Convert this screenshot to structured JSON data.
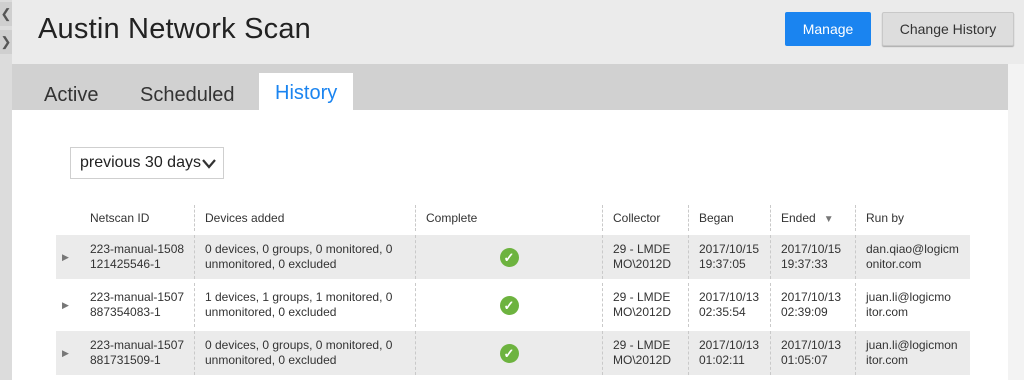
{
  "page": {
    "title": "Austin Network Scan"
  },
  "nav": {
    "back_arrow": "❮",
    "forward_arrow": "❯"
  },
  "header_buttons": {
    "manage": "Manage",
    "change_history": "Change History"
  },
  "tabs": [
    {
      "label": "Active",
      "active": false
    },
    {
      "label": "Scheduled",
      "active": false
    },
    {
      "label": "History",
      "active": true
    }
  ],
  "filter": {
    "selected": "previous 30 days"
  },
  "table": {
    "columns": [
      "Netscan ID",
      "Devices added",
      "Complete",
      "Collector",
      "Began",
      "Ended",
      "Run by"
    ],
    "sort_column": "Ended",
    "rows": [
      {
        "id_1": "223-manual-1508",
        "id_2": "121425546-1",
        "devices_1": "0 devices, 0 groups, 0 monitored, 0",
        "devices_2": "unmonitored, 0 excluded",
        "complete": true,
        "collector_1": "29 - LMDE",
        "collector_2": "MO\\2012D",
        "began_1": "2017/10/15",
        "began_2": "19:37:05",
        "ended_1": "2017/10/15",
        "ended_2": "19:37:33",
        "runby_1": "dan.qiao@logicm",
        "runby_2": "onitor.com"
      },
      {
        "id_1": "223-manual-1507",
        "id_2": "887354083-1",
        "devices_1": "1 devices, 1 groups, 1 monitored, 0",
        "devices_2": "unmonitored, 0 excluded",
        "complete": true,
        "collector_1": "29 - LMDE",
        "collector_2": "MO\\2012D",
        "began_1": "2017/10/13",
        "began_2": "02:35:54",
        "ended_1": "2017/10/13",
        "ended_2": "02:39:09",
        "runby_1": "juan.li@logicmo",
        "runby_2": "itor.com"
      },
      {
        "id_1": "223-manual-1507",
        "id_2": "881731509-1",
        "devices_1": "0 devices, 0 groups, 0 monitored, 0",
        "devices_2": "unmonitored, 0 excluded",
        "complete": true,
        "collector_1": "29 - LMDE",
        "collector_2": "MO\\2012D",
        "began_1": "2017/10/13",
        "began_2": "01:02:11",
        "ended_1": "2017/10/13",
        "ended_2": "01:05:07",
        "runby_1": "juan.li@logicmon",
        "runby_2": "itor.com"
      }
    ]
  },
  "colors": {
    "accent": "#1a84f0",
    "success": "#6db33f",
    "header_bg": "#ebebeb",
    "tabbar_bg": "#d1d1d1"
  },
  "icons": {
    "row_expand": "caret-right-icon",
    "complete": "check-circle-icon",
    "sort": "sort-desc-icon",
    "dropdown": "chevron-down-icon"
  }
}
